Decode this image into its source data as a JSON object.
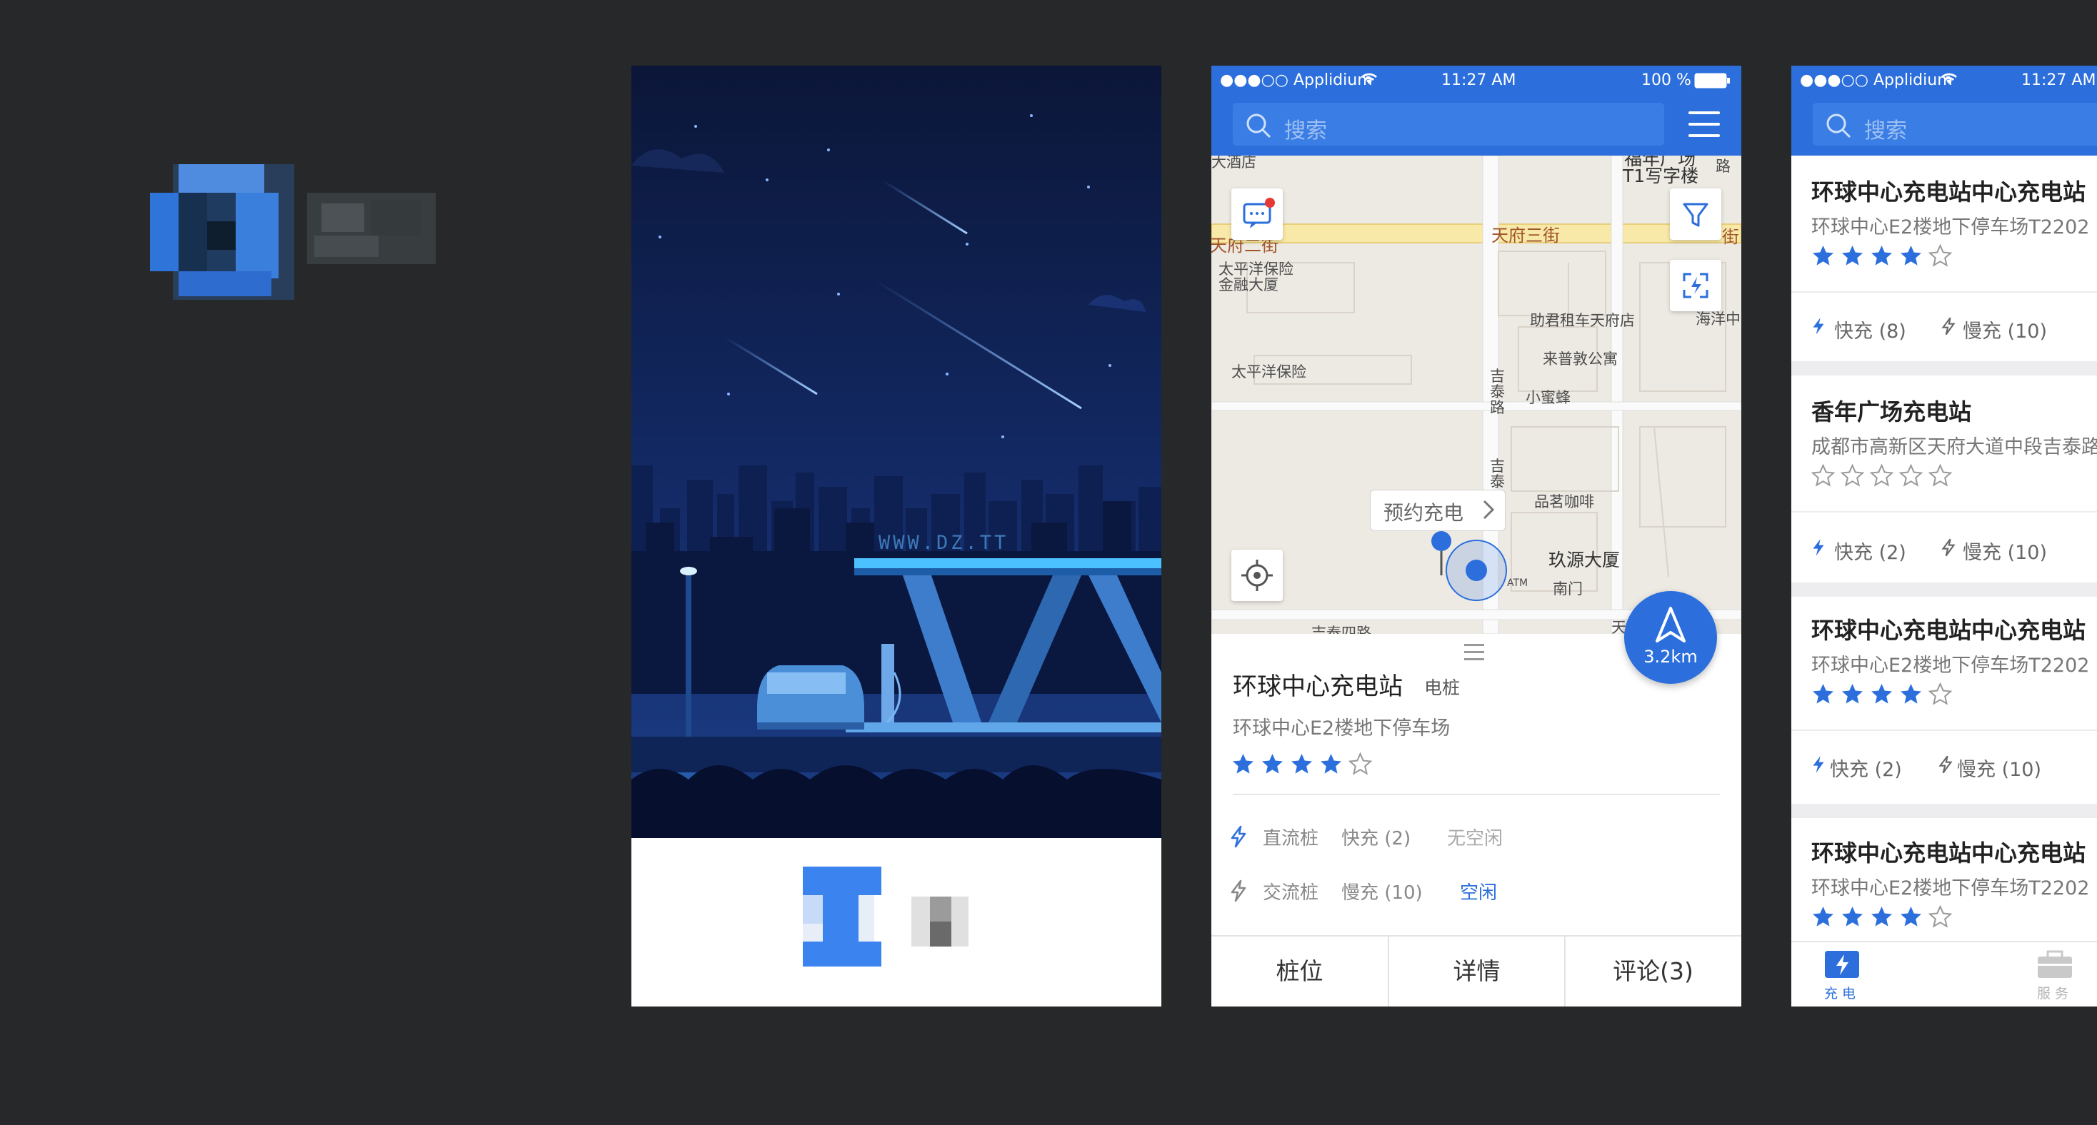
{
  "colors": {
    "background": "#262829",
    "accent": "#2c6fdc",
    "splash_sky": "#0d1b45",
    "star_filled": "#2c6fdc",
    "free_status": "#2c6fdc"
  },
  "brand": {
    "logo_icon": "pixelated-logo-icon"
  },
  "splash": {
    "url": "WWW.DZ.TT",
    "bottom_logo_icon": "pixelated-logo-icon"
  },
  "statusbar": {
    "carrier": "●●●○○ Applidium",
    "time": "11:27 AM",
    "battery": "100 %"
  },
  "search": {
    "placeholder": "搜索"
  },
  "map": {
    "roads": {
      "tianfu3": "天府三街",
      "jitai": "吉泰路",
      "jitai2": "吉泰路",
      "jitai_bottom": "吉泰四路",
      "road_right": "路"
    },
    "pois": {
      "hotel": "大酒店",
      "fuNian1": "福年广场",
      "fuNian2": "T1写字楼",
      "taipingyang1": "太平洋保险",
      "taipingyang2": "金融大厦",
      "taipingyang3": "太平洋保险",
      "tianfu_left": "天府二街",
      "right_edge": "街",
      "zhujun": "助君租车天府店",
      "laipu": "来普敦公寓",
      "xiaomifeng": "小蜜蜂",
      "haiyang": "海洋中",
      "pinming": "品茗咖啡",
      "jiuyuan": "玖源大厦",
      "nanmen": "南门",
      "atm": "ATM",
      "bottom_right": "天"
    },
    "bubble": "预约充电",
    "icons": [
      "message-icon",
      "filter-icon",
      "scan-icon",
      "locate-icon"
    ]
  },
  "detail": {
    "name": "环球中心充电站",
    "type": "电桩",
    "address": "环球中心E2楼地下停车场",
    "rating": 4,
    "distance": "3.2km",
    "dc": {
      "label": "直流桩",
      "count": "快充 (2)",
      "status": "无空闲"
    },
    "ac": {
      "label": "交流桩",
      "count": "慢充 (10)",
      "status": "空闲"
    },
    "tabs": [
      "桩位",
      "详情",
      "评论(3)"
    ]
  },
  "list": {
    "items": [
      {
        "title": "环球中心充电站中心充电站",
        "address": "环球中心E2楼地下停车场T2202",
        "rating": 4,
        "fast": "快充 (8)",
        "slow": "慢充 (10)"
      },
      {
        "title": "香年广场充电站",
        "address": "成都市高新区天府大道中段吉泰路",
        "rating": 0,
        "fast": "快充 (2)",
        "slow": "慢充 (10)"
      },
      {
        "title": "环球中心充电站中心充电站",
        "address": "环球中心E2楼地下停车场T2202",
        "rating": 4,
        "fast": "快充 (2)",
        "slow": "慢充 (10)"
      },
      {
        "title": "环球中心充电站中心充电站",
        "address": "环球中心E2楼地下停车场T2202",
        "rating": 4
      }
    ],
    "nav": [
      {
        "label": "充电",
        "icon": "charge-icon"
      },
      {
        "label": "服务",
        "icon": "toolbox-icon"
      }
    ]
  }
}
